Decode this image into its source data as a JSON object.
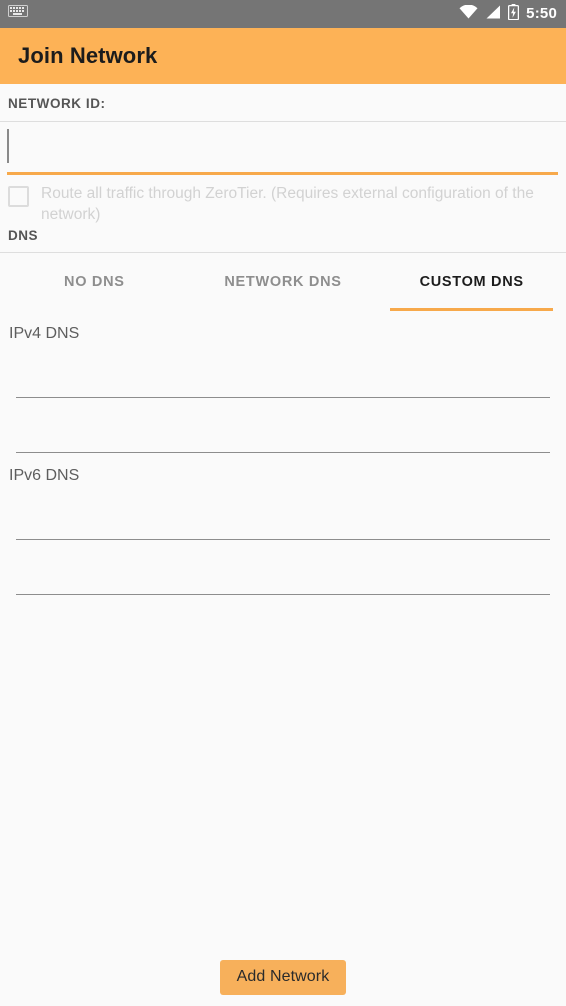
{
  "status_bar": {
    "keyboard_icon": "keyboard-icon",
    "wifi_icon": "wifi-icon",
    "signal_icon": "signal-icon",
    "battery_icon": "battery-charging-icon",
    "time": "5:50",
    "background_color": "#757575",
    "foreground_color": "#ffffff"
  },
  "app_bar": {
    "title": "Join Network",
    "background_color": "#fdb256",
    "title_color": "#1c1c1c"
  },
  "network_id": {
    "section_label": "NETWORK ID:",
    "value": "",
    "placeholder": "",
    "focused": true,
    "underline_color": "#f7a94b"
  },
  "route_all_traffic": {
    "label": "Route all traffic through ZeroTier. (Requires external configuration of the network)",
    "checked": false,
    "enabled": false,
    "text_color": "#d2d2d2"
  },
  "dns": {
    "section_label": "DNS",
    "tabs": [
      {
        "label": "NO DNS",
        "active": false
      },
      {
        "label": "NETWORK DNS",
        "active": false
      },
      {
        "label": "CUSTOM DNS",
        "active": true
      }
    ],
    "active_tab_indicator_color": "#f7a94b",
    "groups": [
      {
        "label": "IPv4 DNS",
        "fields": [
          {
            "value": "",
            "placeholder": ""
          },
          {
            "value": "",
            "placeholder": ""
          }
        ]
      },
      {
        "label": "IPv6 DNS",
        "fields": [
          {
            "value": "",
            "placeholder": ""
          },
          {
            "value": "",
            "placeholder": ""
          }
        ]
      }
    ]
  },
  "footer": {
    "add_button_label": "Add Network",
    "add_button_color": "#f7b05b",
    "add_button_text_color": "#2b2b2b"
  },
  "page": {
    "background_color": "#fafafa"
  }
}
